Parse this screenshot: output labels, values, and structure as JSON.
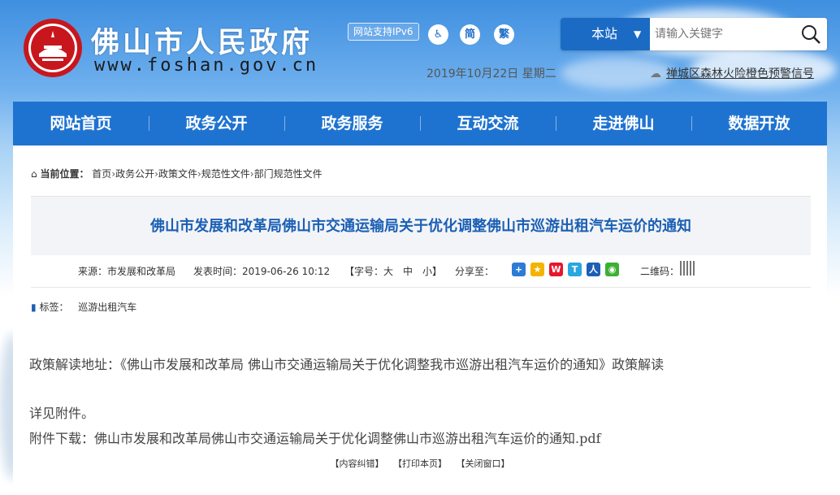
{
  "header": {
    "site_title": "佛山市人民政府",
    "site_url": "www.foshan.gov.cn",
    "ipv6_badge": "网站支持IPv6",
    "simplified_label": "简",
    "traditional_label": "繁",
    "date": "2019年10月22日 星期二",
    "alert_text": "禅城区森林火险橙色预警信号"
  },
  "search": {
    "scope": "本站",
    "placeholder": "请输入关键字"
  },
  "nav": {
    "items": [
      "网站首页",
      "政务公开",
      "政务服务",
      "互动交流",
      "走进佛山",
      "数据开放"
    ]
  },
  "breadcrumb": {
    "label": "当前位置：",
    "items": [
      "首页",
      "政务公开",
      "政策文件",
      "规范性文件",
      "部门规范性文件"
    ],
    "separator": "›"
  },
  "article": {
    "title": "佛山市发展和改革局佛山市交通运输局关于优化调整佛山市巡游出租汽车运价的通知",
    "source": "来源：市发展和改革局",
    "published": "发表时间：2019-06-26 10:12",
    "font_size_label": "【字号：大　中　小】",
    "share_label": "分享至：",
    "qr_label": "二维码：",
    "tags_label": "标签：",
    "tag": "巡游出租汽车",
    "paragraphs": [
      "政策解读地址：《佛山市发展和改革局 佛山市交通运输局关于优化调整我市巡游出租汽车运价的通知》政策解读",
      "详见附件。",
      "附件下载：佛山市发展和改革局佛山市交通运输局关于优化调整佛山市巡游出租汽车运价的通知.pdf"
    ],
    "actions": [
      "【内容纠错】",
      "【打印本页】",
      "【关闭窗口】"
    ]
  },
  "colors": {
    "nav_bg": "#1f73d0",
    "title_blue": "#1a5fb4",
    "scope_bg": "#1b6bc5"
  },
  "share_icons": [
    "plus-share-icon",
    "qzone-icon",
    "weibo-icon",
    "tencent-weibo-icon",
    "renren-icon",
    "wechat-icon"
  ]
}
